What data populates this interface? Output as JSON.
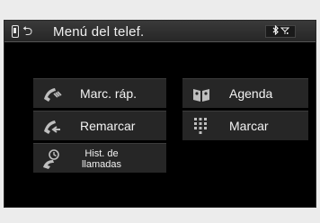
{
  "header": {
    "title": "Menú del telef.",
    "back_icon": "phone-back-icon",
    "status_icons": [
      "bluetooth-icon",
      "signal-icon"
    ]
  },
  "menu": {
    "speed_dial": {
      "label": "Marc. ráp.",
      "icon": "speed-dial-icon"
    },
    "phonebook": {
      "label": "Agenda",
      "icon": "phonebook-icon"
    },
    "redial": {
      "label": "Remarcar",
      "icon": "redial-icon"
    },
    "dial": {
      "label": "Marcar",
      "icon": "keypad-icon"
    },
    "call_history": {
      "label_line1": "Hist. de",
      "label_line2": "llamadas",
      "icon": "call-history-icon"
    }
  },
  "colors": {
    "background": "#000000",
    "button": "#262626",
    "text": "#f2f2f2"
  }
}
